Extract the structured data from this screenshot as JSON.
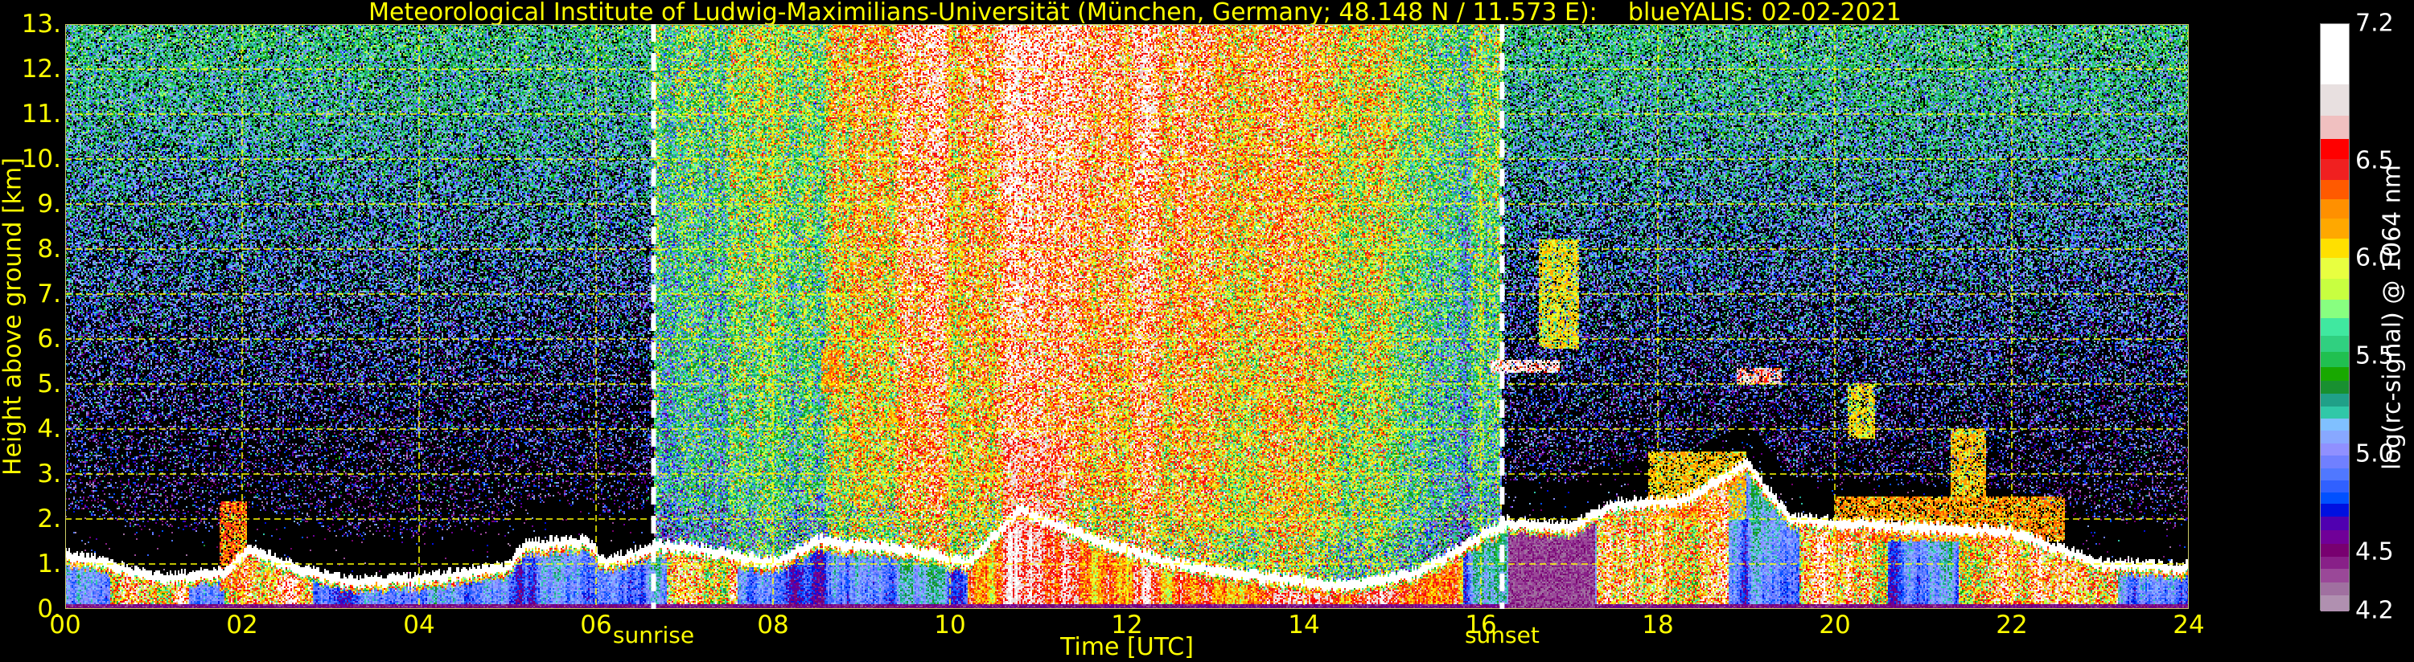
{
  "title": "Meteorological Institute of Ludwig-Maximilians-Universität (München, Germany; 48.148 N / 11.573 E):    blueYALIS: 02-02-2021",
  "chart_data": {
    "type": "heatmap",
    "title": "Meteorological Institute of Ludwig-Maximilians-Universität (München, Germany; 48.148 N / 11.573 E):    blueYALIS: 02-02-2021",
    "xlabel": "Time [UTC]",
    "ylabel": "Height above ground [km]",
    "xlim": [
      0,
      24
    ],
    "ylim": [
      0,
      13
    ],
    "grid": true,
    "x_ticks": [
      "00",
      "02",
      "04",
      "06",
      "08",
      "10",
      "12",
      "14",
      "16",
      "18",
      "20",
      "22",
      "24"
    ],
    "x_tick_values": [
      0,
      2,
      4,
      6,
      8,
      10,
      12,
      14,
      16,
      18,
      20,
      22,
      24
    ],
    "y_ticks": [
      "0.",
      "1.",
      "2.",
      "3.",
      "4.",
      "5.",
      "6.",
      "7.",
      "8.",
      "9.",
      "10.",
      "11.",
      "12.",
      "13."
    ],
    "y_tick_values": [
      0,
      1,
      2,
      3,
      4,
      5,
      6,
      7,
      8,
      9,
      10,
      11,
      12,
      13
    ],
    "events": [
      {
        "label": "sunrise",
        "time": 6.65
      },
      {
        "label": "sunset",
        "time": 16.24
      }
    ],
    "colorbar": {
      "label": "log(rc-signal) @ 1064 nm",
      "range": [
        4.2,
        7.2
      ],
      "ticks": [
        "4.2",
        "4.5",
        "5.0",
        "5.5",
        "6.0",
        "6.5",
        "7.2"
      ],
      "tick_values": [
        4.2,
        4.5,
        5.0,
        5.5,
        6.0,
        6.5,
        7.2
      ],
      "boundaries": [
        4.2,
        4.285,
        4.35,
        4.42,
        4.48,
        4.546,
        4.615,
        4.685,
        4.75,
        4.811,
        4.872,
        4.933,
        4.998,
        5.059,
        5.124,
        5.185,
        5.25,
        5.315,
        5.38,
        5.45,
        5.528,
        5.611,
        5.698,
        5.793,
        5.902,
        6.007,
        6.107,
        6.207,
        6.307,
        6.407,
        6.511,
        6.617,
        6.733,
        6.896,
        7.2
      ],
      "colors": [
        "#b090b0",
        "#a070a0",
        "#9a4898",
        "#882088",
        "#780070",
        "#700098",
        "#5000b0",
        "#0010e0",
        "#0050ff",
        "#3060ff",
        "#5078ff",
        "#7080ff",
        "#9090ff",
        "#88a8ff",
        "#80c0ff",
        "#30c8a8",
        "#20a088",
        "#189030",
        "#18a800",
        "#20c050",
        "#30d080",
        "#40e8a0",
        "#88ff80",
        "#c8ff40",
        "#e8ff40",
        "#ffe000",
        "#ffa800",
        "#ff9000",
        "#ff5a00",
        "#f02020",
        "#ff0000",
        "#f0c0c0",
        "#e8e0e0",
        "#ffffff"
      ]
    },
    "boundary_layer_top_km": [
      [
        0,
        1.2
      ],
      [
        0.5,
        1.0
      ],
      [
        1,
        0.65
      ],
      [
        1.8,
        0.8
      ],
      [
        2.1,
        1.3
      ],
      [
        2.6,
        0.9
      ],
      [
        3.2,
        0.6
      ],
      [
        4,
        0.65
      ],
      [
        5,
        0.9
      ],
      [
        5.2,
        1.4
      ],
      [
        5.9,
        1.5
      ],
      [
        6.1,
        1.0
      ],
      [
        6.7,
        1.4
      ],
      [
        7.2,
        1.3
      ],
      [
        8,
        1.0
      ],
      [
        8.5,
        1.5
      ],
      [
        9.5,
        1.3
      ],
      [
        10.2,
        1.0
      ],
      [
        10.8,
        2.2
      ],
      [
        11.5,
        1.6
      ],
      [
        12.5,
        1.0
      ],
      [
        13.5,
        0.7
      ],
      [
        14.5,
        0.5
      ],
      [
        15.3,
        0.8
      ],
      [
        16,
        1.6
      ],
      [
        16.3,
        1.9
      ],
      [
        17,
        1.8
      ],
      [
        17.5,
        2.3
      ],
      [
        18.3,
        2.4
      ],
      [
        19,
        3.2
      ],
      [
        19.5,
        2.0
      ],
      [
        20,
        1.9
      ],
      [
        21,
        1.8
      ],
      [
        22,
        1.7
      ],
      [
        23,
        1.0
      ],
      [
        24,
        0.9
      ]
    ],
    "elevated_layers": [
      {
        "t0": 1.75,
        "t1": 2.05,
        "h0": 0.4,
        "h1": 2.4,
        "level": 6.5
      },
      {
        "t0": 8.55,
        "t1": 8.8,
        "h0": 4.8,
        "h1": 5.8,
        "level": 6.4
      },
      {
        "t0": 9.3,
        "t1": 9.5,
        "h0": 4.1,
        "h1": 4.5,
        "level": 6.2
      },
      {
        "t0": 10.6,
        "t1": 11.3,
        "h0": 1.6,
        "h1": 3.8,
        "level": 6.7
      },
      {
        "t0": 16.1,
        "t1": 16.9,
        "h0": 5.25,
        "h1": 5.55,
        "level": 7.0
      },
      {
        "t0": 16.65,
        "t1": 17.1,
        "h0": 5.8,
        "h1": 8.2,
        "level": 6.2
      },
      {
        "t0": 18.9,
        "t1": 19.4,
        "h0": 5.0,
        "h1": 5.35,
        "level": 6.9
      },
      {
        "t0": 20.15,
        "t1": 20.45,
        "h0": 3.8,
        "h1": 5.0,
        "level": 6.2
      },
      {
        "t0": 21.3,
        "t1": 21.7,
        "h0": 2.4,
        "h1": 4.0,
        "level": 6.3
      },
      {
        "t0": 20.0,
        "t1": 22.6,
        "h0": 1.5,
        "h1": 2.5,
        "level": 6.4
      },
      {
        "t0": 17.9,
        "t1": 19.0,
        "h0": 2.0,
        "h1": 3.5,
        "level": 6.3
      }
    ]
  }
}
